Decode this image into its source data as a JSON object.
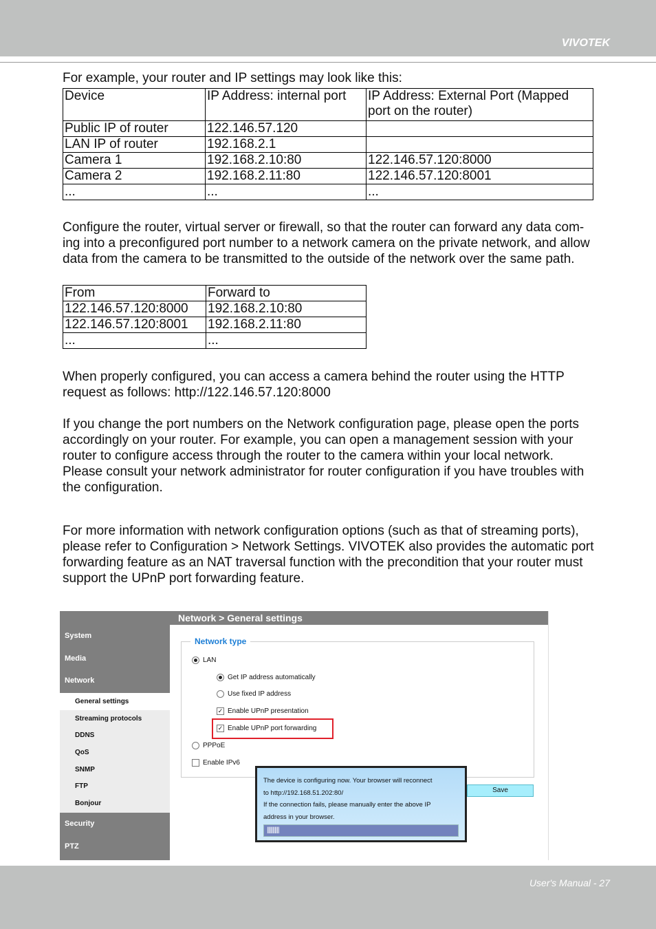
{
  "header": {
    "brand": "VIVOTEK"
  },
  "footer": {
    "page_label": "User's Manual - 27"
  },
  "intro": "For example, your router and IP settings may look like this:",
  "table1": {
    "headers": [
      "Device",
      "IP Address: internal port",
      "IP Address: External Port (Mapped port on the router)"
    ],
    "rows": [
      [
        "Public IP of router",
        "122.146.57.120",
        ""
      ],
      [
        "LAN IP of router",
        "192.168.2.1",
        ""
      ],
      [
        "Camera 1",
        "192.168.2.10:80",
        "122.146.57.120:8000"
      ],
      [
        "Camera 2",
        "192.168.2.11:80",
        "122.146.57.120:8001"
      ],
      [
        "...",
        "...",
        "..."
      ]
    ]
  },
  "para1": "Configure the router, virtual server or firewall, so that the router can forward any data com-ing into a preconfigured port number to a network camera on the private network, and allow data from the camera to be transmitted to the outside of the network over the same path.",
  "table2": {
    "headers": [
      "From",
      "Forward to"
    ],
    "rows": [
      [
        "122.146.57.120:8000",
        "192.168.2.10:80"
      ],
      [
        "122.146.57.120:8001",
        "192.168.2.11:80"
      ],
      [
        "...",
        "..."
      ]
    ]
  },
  "para2": "When properly configured, you can access a camera behind the router using the HTTP request as follows: http://122.146.57.120:8000",
  "para3": "If you change the port numbers on the Network configuration page, please open the ports accordingly on your router. For example, you can open a management session with your router to configure access through the router to the camera within your local network. Please consult your network administrator for router configuration if you have troubles with the configuration.",
  "para4": "For more information with network configuration options (such as that of streaming ports), please refer to Configuration > Network Settings. VIVOTEK also provides the automatic port forwarding feature as an NAT traversal function with the precondition that your router must support the UPnP port forwarding feature.",
  "ui": {
    "breadcrumb": "Network  > General settings",
    "sidebar_top": [
      "System",
      "Media",
      "Network"
    ],
    "sidebar_sub": [
      "General settings",
      "Streaming protocols",
      "DDNS",
      "QoS",
      "SNMP",
      "FTP",
      "Bonjour"
    ],
    "sidebar_bottom": [
      "Security",
      "PTZ"
    ],
    "legend": "Network type",
    "options": {
      "lan": "LAN",
      "auto": "Get IP address automatically",
      "fixed": "Use fixed IP address",
      "upnp_pres": "Enable UPnP presentation",
      "upnp_fwd": "Enable UPnP port forwarding",
      "pppoe": "PPPoE",
      "ipv6": "Enable IPv6"
    },
    "popup": {
      "line1": "The device is configuring now. Your browser will reconnect",
      "line2": "to http://192.168.51.202:80/",
      "line3": "If the connection fails, please manually enter the above IP",
      "line4": "address in your browser.",
      "progress": "|||||||||||"
    },
    "save": "Save",
    "highlight_color": "#e0202a",
    "accent": "#1e7fd6"
  }
}
